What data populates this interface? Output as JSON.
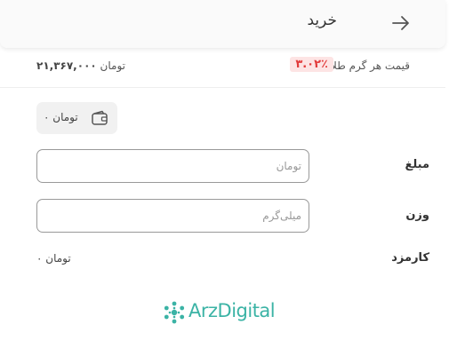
{
  "header": {
    "title": "خرید"
  },
  "price": {
    "label": "قیمت هر گرم طلا",
    "change": "۳.۰۲٪",
    "value": "۲۱,۳۶۷,۰۰۰",
    "unit": "تومان"
  },
  "wallet": {
    "balance_text": "۰ تومان"
  },
  "form": {
    "amount_label": "مبلغ",
    "amount_placeholder": "تومان",
    "weight_label": "وزن",
    "weight_placeholder": "میلی‌گرم",
    "fee_label": "کارمزد",
    "fee_value": "۰ تومان"
  },
  "logo": {
    "text": "ArzDigital"
  },
  "colors": {
    "negative": "#e23b3b",
    "negative_bg": "#fde4e4",
    "brand": "#3bb3a5"
  }
}
